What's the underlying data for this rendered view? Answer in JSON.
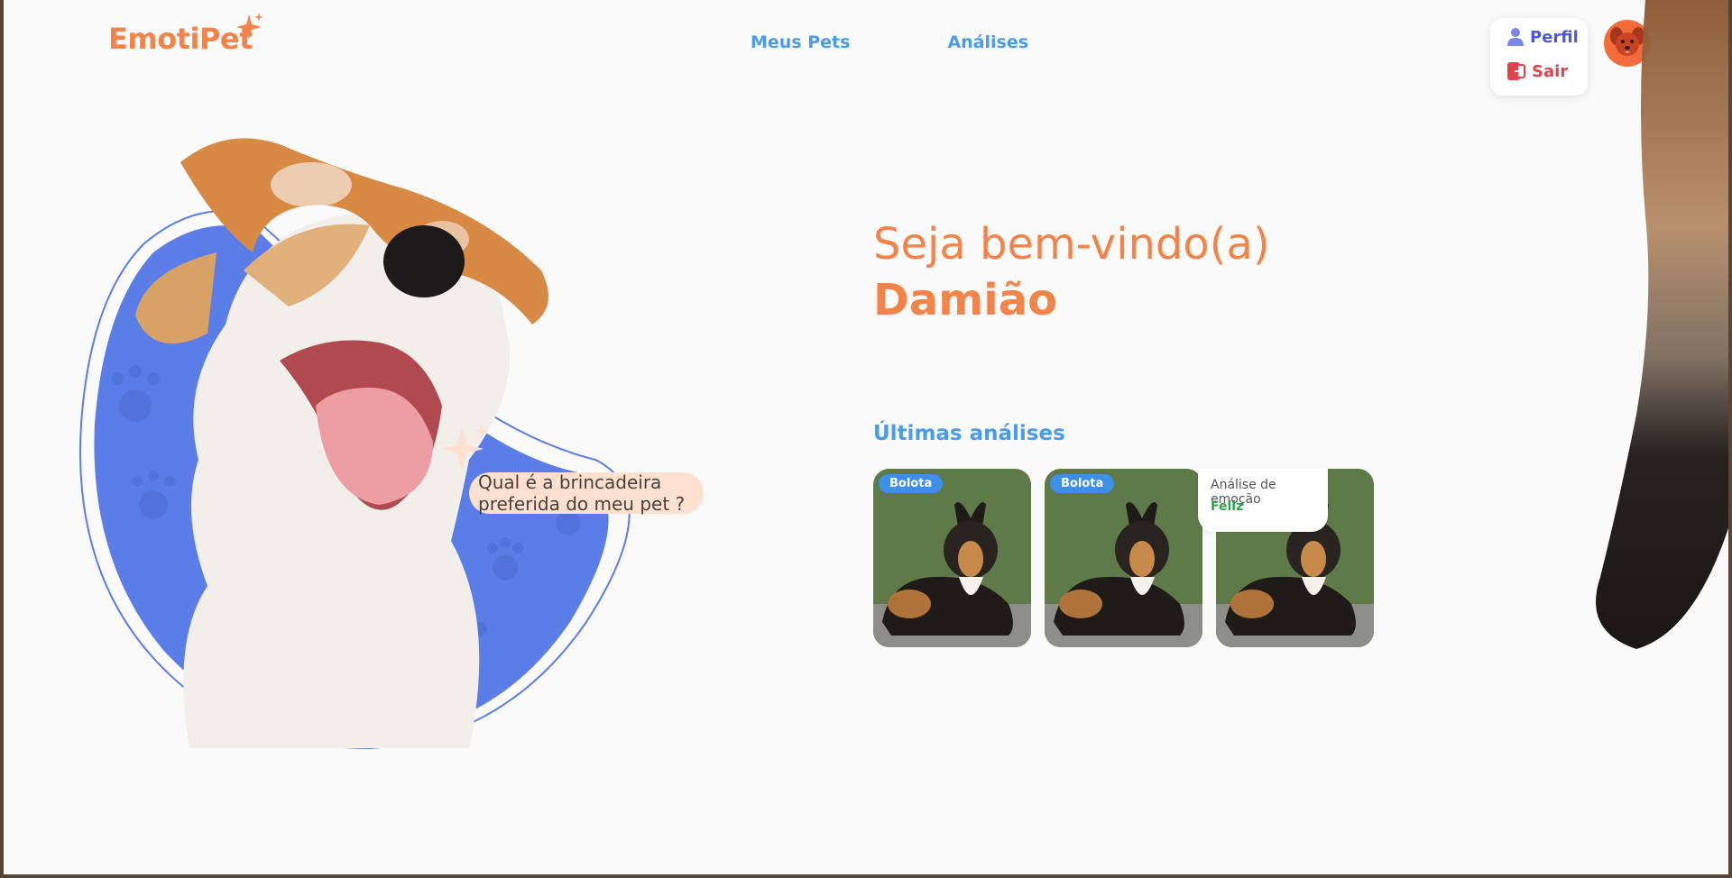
{
  "brand": {
    "name": "EmotiPet",
    "accent": "#f2844a"
  },
  "nav": {
    "items": [
      {
        "label": "Meus Pets"
      },
      {
        "label": "Análises"
      }
    ]
  },
  "profile_menu": {
    "perfil_label": "Perfil",
    "sair_label": "Sair"
  },
  "hero": {
    "bubble_text": "Qual é a brincadeira preferida do meu pet ?"
  },
  "welcome": {
    "greeting": "Seja bem-vindo(a)",
    "user_name": "Damião"
  },
  "analyses": {
    "title": "Últimas análises",
    "cards": [
      {
        "pet_name": "Bolota"
      },
      {
        "pet_name": "Bolota"
      },
      {
        "pet_name": ""
      }
    ],
    "tooltip": {
      "label": "Análise de emoção",
      "emotion": "Feliz"
    }
  },
  "colors": {
    "link": "#4a9be8",
    "blob": "#5a7de8",
    "danger": "#e0424b",
    "success": "#2ea44f"
  }
}
